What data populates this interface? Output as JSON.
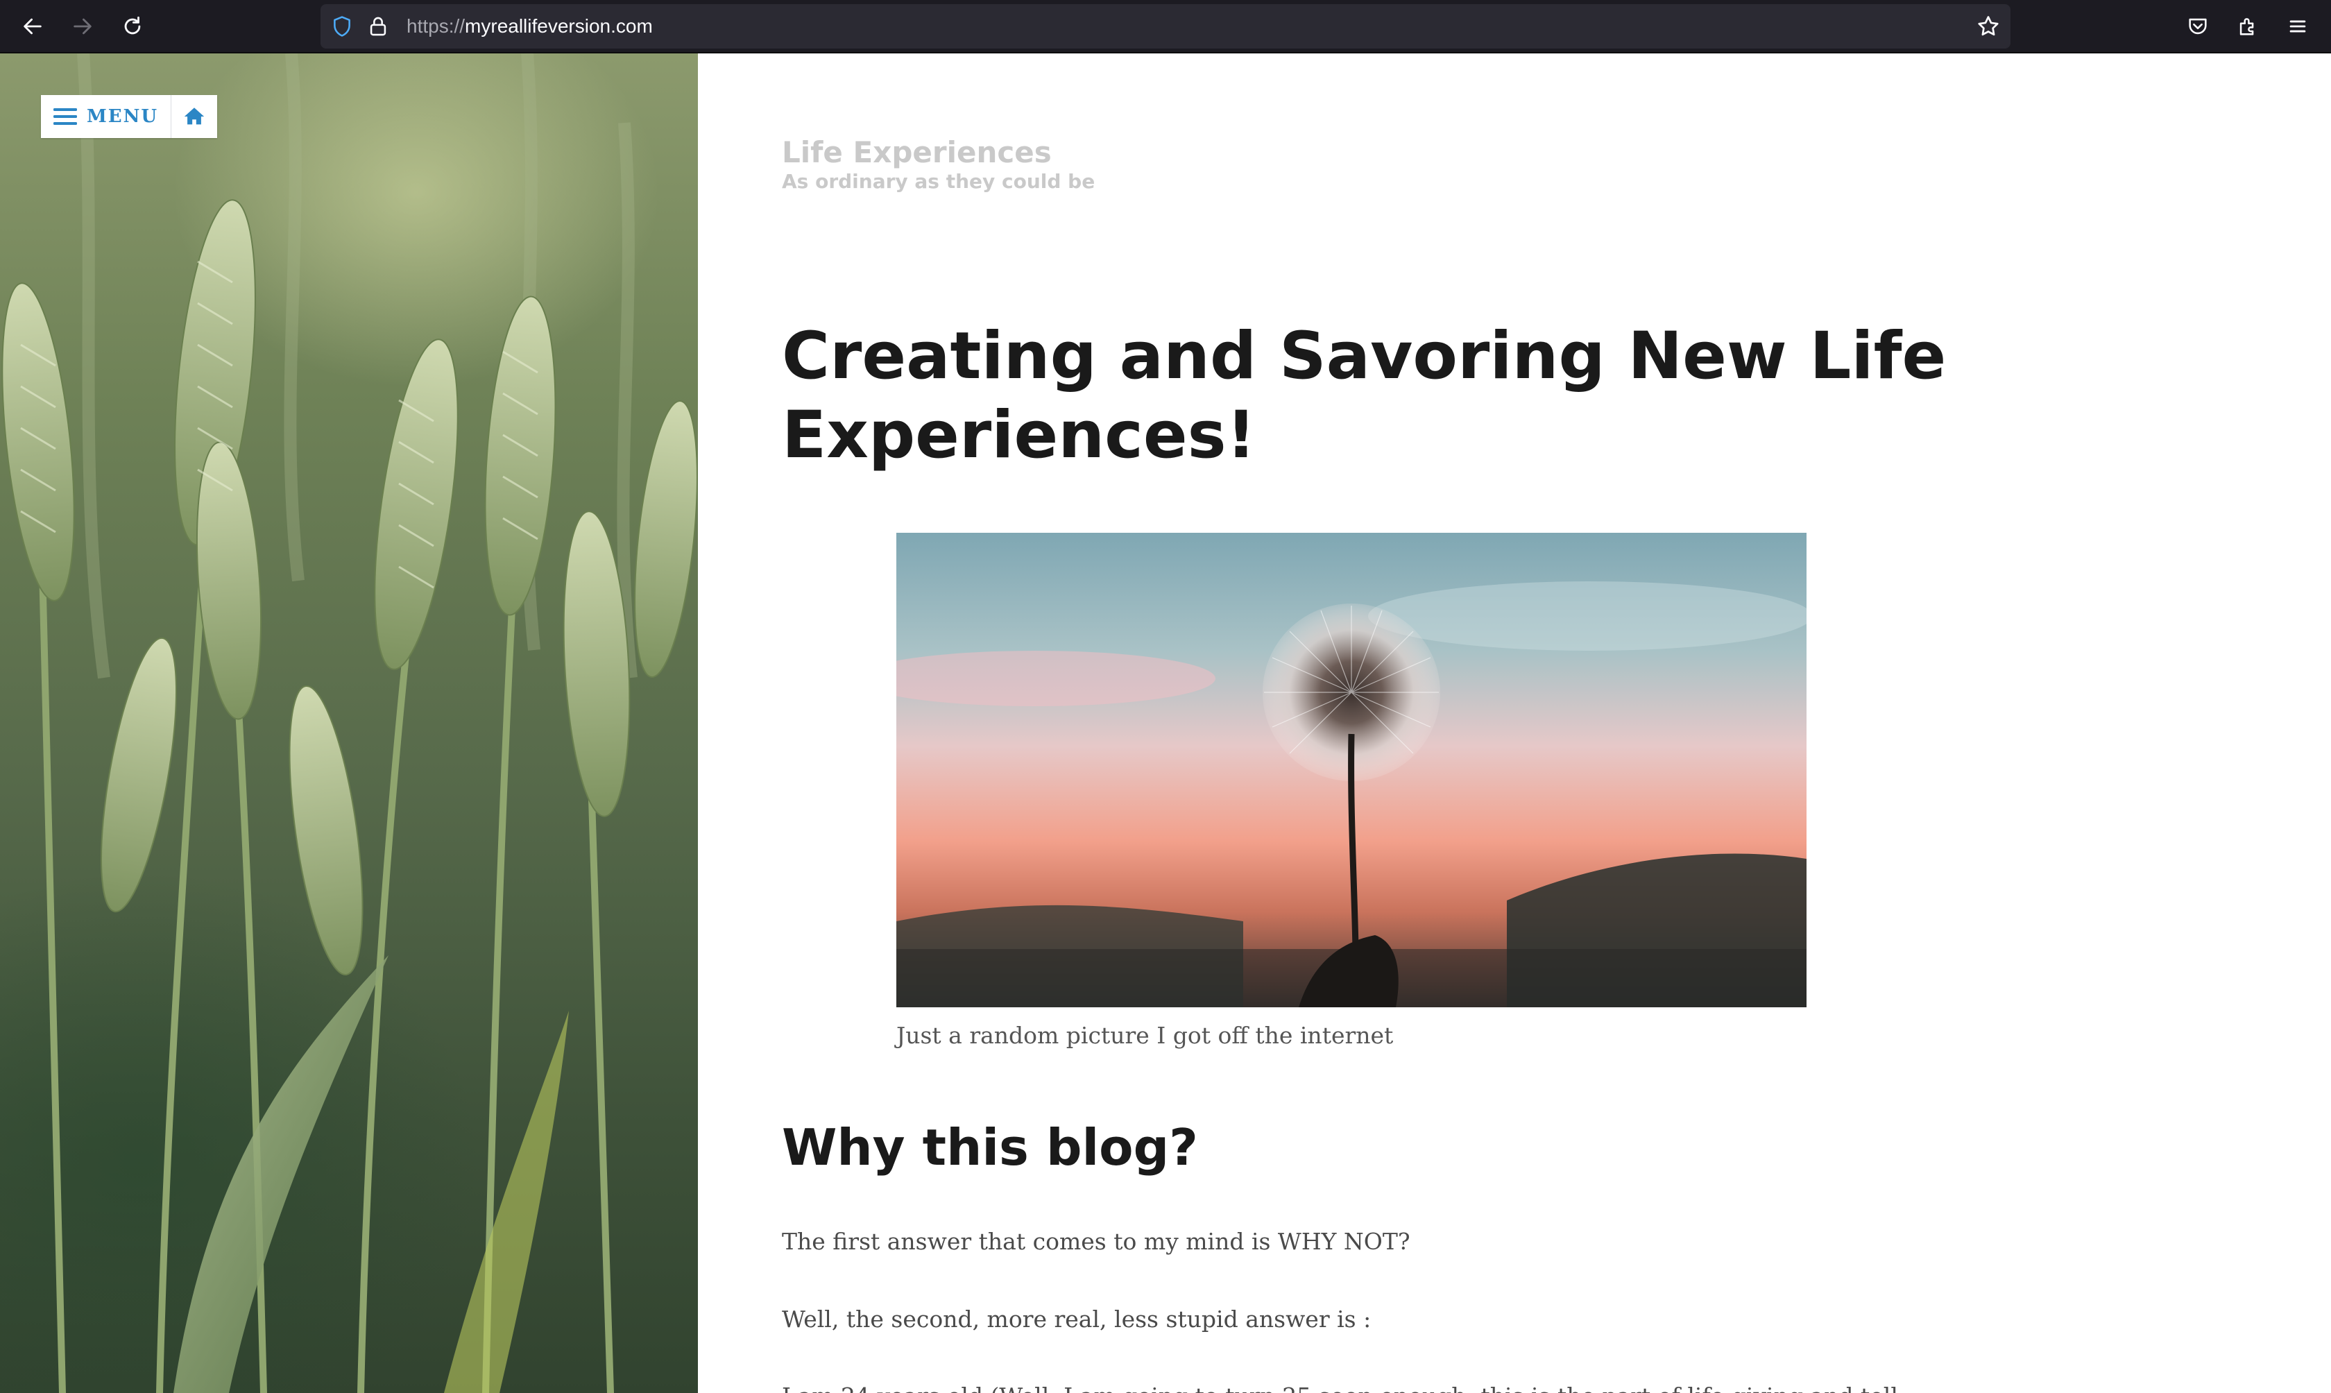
{
  "browser": {
    "url_protocol": "https://",
    "url_host": "myreallifeversion.com"
  },
  "sidebar": {
    "menu_label": "MENU"
  },
  "site": {
    "title": "Life Experiences",
    "tagline": "As ordinary as they could be"
  },
  "post": {
    "title": "Creating and Savoring New Life Experiences!",
    "image_caption": "Just a random picture I got off the internet",
    "heading": "Why this blog?",
    "paragraphs": [
      "The first answer that comes to my mind is WHY NOT?",
      "Well, the second, more real, less stupid answer is :",
      "I am 24 years old (Well, I am going to turn 25 soon enough, this is the part of life giving and tell"
    ]
  },
  "colors": {
    "accent": "#2b86c5",
    "chrome_bg": "#1c1b22",
    "urlbar_bg": "#2b2a33"
  },
  "icons": [
    "back-icon",
    "forward-icon",
    "reload-icon",
    "shield-icon",
    "lock-icon",
    "star-icon",
    "pocket-icon",
    "extensions-icon",
    "app-menu-icon",
    "hamburger-icon",
    "home-icon"
  ]
}
